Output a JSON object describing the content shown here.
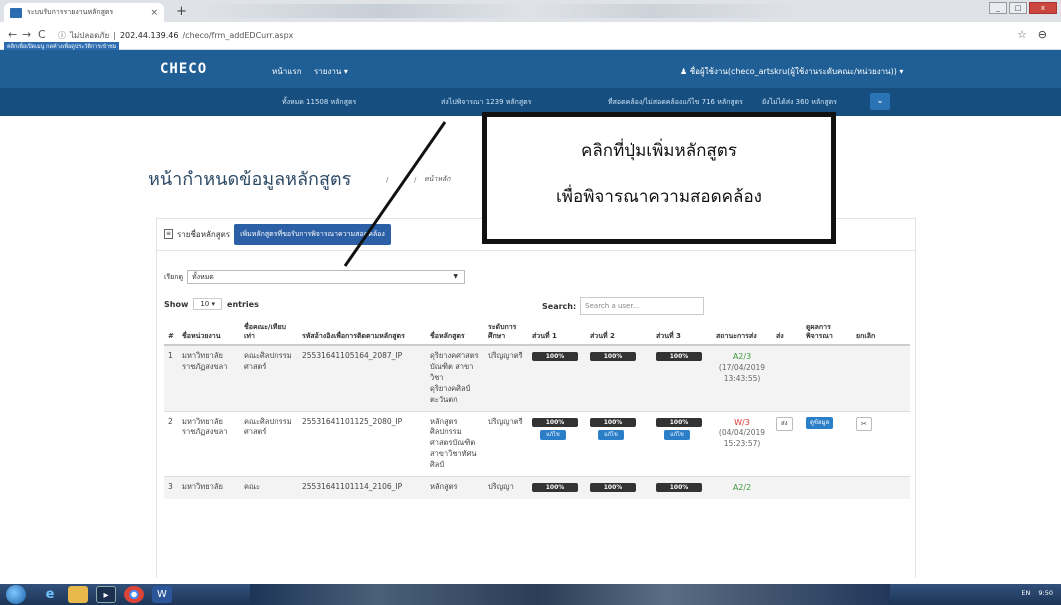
{
  "browser": {
    "tab_title": "ระบบรับการรายงานหลักสูตร",
    "tab_close": "×",
    "new_tab": "+",
    "back": "←",
    "forward": "→",
    "reload": "C",
    "security_label": "ไม่ปลอดภัย",
    "url_host": "202.44.139.46",
    "url_path": "/checo/frm_addEDCurr.aspx",
    "tooltip": "คลิกเพื่อเปิดเมนู กดค้างเพื่อดูประวัติการเข้าชม",
    "star": "☆",
    "account": "⊖"
  },
  "navbar": {
    "brand": "CHECO",
    "home": "หน้าแรก",
    "reports": "รายงาน ▾",
    "user": "ชื่อผู้ใช้งาน(checo_artskru(ผู้ใช้งานระดับคณะ/หน่วยงาน)) ▾"
  },
  "stats": {
    "total": "ทั้งหมด 11508 หลักสูตร",
    "sent": "ส่งไปพิจารณา 1239 หลักสูตร",
    "under_review": "ที่สอดคล้อง/ไม่สอดคล้องแก้ไข 716 หลักสูตร",
    "not_sent": "ยังไม่ได้ส่ง 360 หลักสูตร",
    "expand": "⌄"
  },
  "page": {
    "title": "หน้ากำหนดข้อมูลหลักสูตร",
    "sep": "/",
    "crumb": "หน้าหลัก"
  },
  "callout": {
    "line1": "คลิกที่ปุ่มเพิ่มหลักสูตร",
    "line2": "เพื่อพิจารณาความสอดคล้อง"
  },
  "panel": {
    "list_label": "รายชื่อหลักสูตร",
    "add_button": "เพิ่มหลักสูตรที่ขอรับการพิจารณาความสอดคล้อง",
    "sort_label": "เรียกดู",
    "sort_value": "ทั้งหมด",
    "show_label": "Show",
    "show_value": "10",
    "entries_label": "entries",
    "search_label": "Search:",
    "search_placeholder": "Search a user..."
  },
  "table": {
    "headers": {
      "num": "#",
      "unit": "ชื่อหน่วยงาน",
      "faculty": "ชื่อคณะ/เทียบเท่า",
      "ref": "รหัสอ้างอิงเพื่อการติดตามหลักสูตร",
      "name": "ชื่อหลักสูตร",
      "level": "ระดับการศึกษา",
      "part1": "ส่วนที่ 1",
      "part2": "ส่วนที่ 2",
      "part3": "ส่วนที่ 3",
      "status": "สถานะการส่ง",
      "send": "ส่ง",
      "result": "ดูผลการพิจารณา",
      "cancel": "ยกเลิก"
    },
    "rows": [
      {
        "num": "1",
        "unit": "มหาวิทยาลัยราชภัฏสงขลา",
        "faculty": "คณะศิลปกรรมศาสตร์",
        "ref": "25531641105164_2087_IP",
        "name": "ดุริยางคศาสตรบัณฑิต สาขาวิชาดุริยางคศิลป์ตะวันตก",
        "level": "ปริญญาตรี",
        "p1": "100%",
        "p2": "100%",
        "p3": "100%",
        "status_code": "A2/3",
        "status_date": "(17/04/2019 13:43:55)"
      },
      {
        "num": "2",
        "unit": "มหาวิทยาลัยราชภัฏสงขลา",
        "faculty": "คณะศิลปกรรมศาสตร์",
        "ref": "25531641101125_2080_IP",
        "name": "หลักสูตรศิลปกรรมศาสตรบัณฑิต สาขาวิชาทัศนศิลป์",
        "level": "ปริญญาตรี",
        "p1": "100%",
        "p2": "100%",
        "p3": "100%",
        "edit": "แก้ไข",
        "status_code": "W/3",
        "status_date": "(04/04/2019 15:23:57)",
        "send_btn": "ส่ง",
        "view_btn": "ดูข้อมูล",
        "cancel_btn": "✂"
      },
      {
        "num": "3",
        "unit": "มหาวิทยาลัย",
        "faculty": "คณะ",
        "ref": "25531641101114_2106_IP",
        "name": "หลักสูตร",
        "level": "ปริญญา",
        "p1": "100%",
        "p2": "100%",
        "p3": "100%",
        "status_code": "A2/2"
      }
    ]
  },
  "taskbar": {
    "word": "W",
    "lang": "EN",
    "time": "9:50"
  }
}
